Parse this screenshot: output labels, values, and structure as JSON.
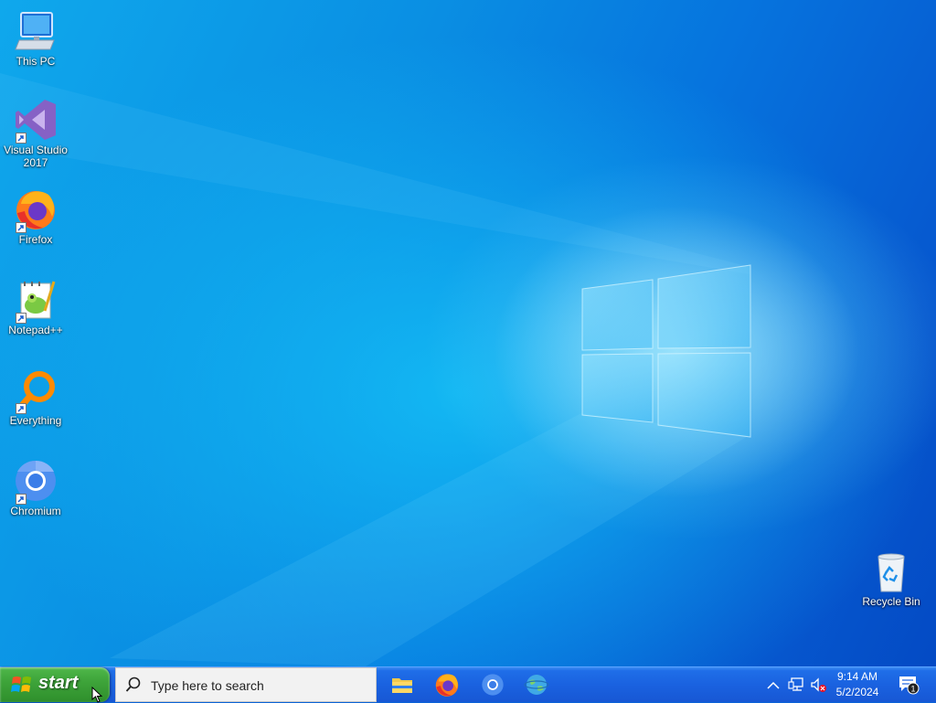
{
  "desktop": {
    "icons": [
      {
        "label": "This PC",
        "icon": "computer-icon"
      },
      {
        "label": "Visual Studio 2017",
        "icon": "visual-studio-icon"
      },
      {
        "label": "Firefox",
        "icon": "firefox-icon"
      },
      {
        "label": "Notepad++",
        "icon": "notepadpp-icon"
      },
      {
        "label": "Everything",
        "icon": "everything-icon"
      },
      {
        "label": "Chromium",
        "icon": "chromium-icon"
      },
      {
        "label": "Recycle Bin",
        "icon": "recycle-bin-icon"
      }
    ]
  },
  "taskbar": {
    "start_label": "start",
    "search_placeholder": "Type here to search",
    "pinned": [
      {
        "name": "File Explorer",
        "icon": "folder-icon"
      },
      {
        "name": "Firefox",
        "icon": "firefox-icon"
      },
      {
        "name": "Chromium",
        "icon": "chromium-icon"
      },
      {
        "name": "Web browser",
        "icon": "globe-icon"
      }
    ],
    "tray": {
      "time": "9:14 AM",
      "date": "5/2/2024",
      "notification_count": "1"
    }
  },
  "colors": {
    "taskbar": "#1a62e0",
    "start_button": "#3ea43a",
    "desktop_blue": "#0a8fe3"
  }
}
